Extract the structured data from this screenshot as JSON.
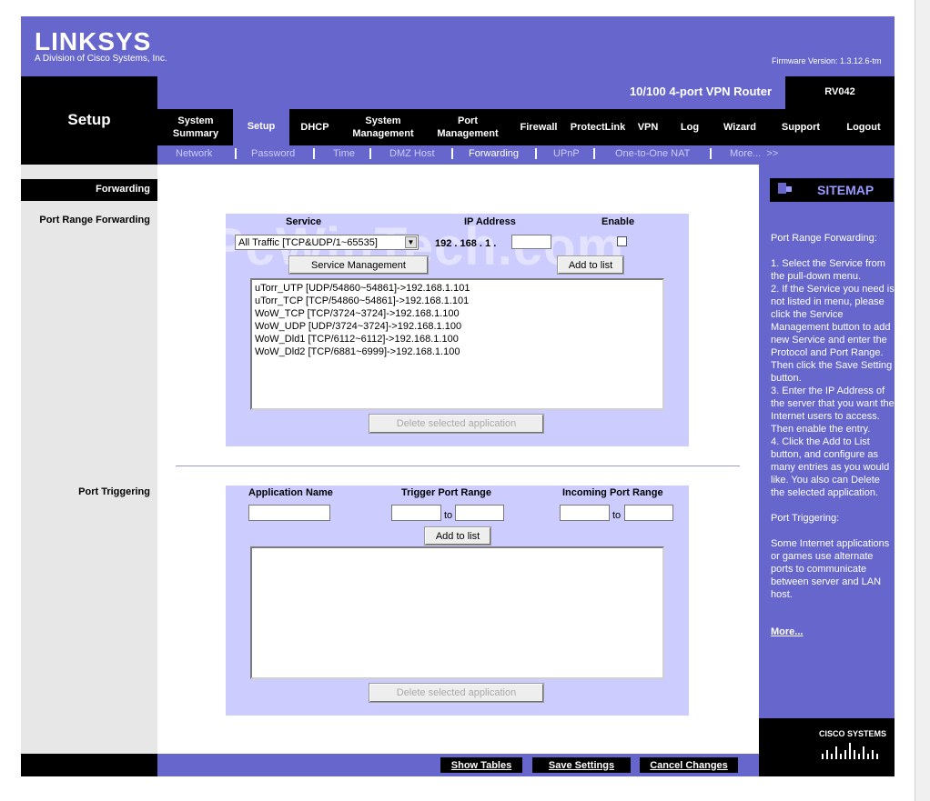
{
  "header": {
    "brand": "LINKSYS",
    "brand_tagline": "A Division of Cisco Systems, Inc.",
    "firmware": "Firmware Version: 1.3.12.6-tm",
    "product": "10/100 4-port VPN Router",
    "model": "RV042",
    "section_title": "Setup"
  },
  "tabs": [
    {
      "label": "System\nSummary"
    },
    {
      "label": "Setup"
    },
    {
      "label": "DHCP"
    },
    {
      "label": "System\nManagement"
    },
    {
      "label": "Port\nManagement"
    },
    {
      "label": "Firewall"
    },
    {
      "label": "ProtectLink"
    },
    {
      "label": "VPN"
    },
    {
      "label": "Log"
    },
    {
      "label": "Wizard"
    },
    {
      "label": "Support"
    },
    {
      "label": "Logout"
    }
  ],
  "subtabs": [
    {
      "label": "Network"
    },
    {
      "label": "Password"
    },
    {
      "label": "Time"
    },
    {
      "label": "DMZ Host"
    },
    {
      "label": "Forwarding"
    },
    {
      "label": "UPnP"
    },
    {
      "label": "One-to-One NAT"
    },
    {
      "label": "More...  >>"
    }
  ],
  "left": {
    "section": "Forwarding",
    "port_range_forwarding": "Port Range Forwarding",
    "port_triggering": "Port Triggering"
  },
  "forwarding": {
    "col_service": "Service",
    "col_ip": "IP Address",
    "col_enable": "Enable",
    "service_selected": "All Traffic [TCP&UDP/1~65535]",
    "ip_prefix": "192 . 168 . 1 .",
    "ip_last": "",
    "service_mgmt_btn": "Service Management",
    "add_btn": "Add to list",
    "entries": [
      "uTorr_UTP [UDP/54860~54861]->192.168.1.101",
      "uTorr_TCP [TCP/54860~54861]->192.168.1.101",
      "WoW_TCP [TCP/3724~3724]->192.168.1.100",
      "WoW_UDP [UDP/3724~3724]->192.168.1.100",
      "WoW_Dld1 [TCP/6112~6112]->192.168.1.100",
      "WoW_Dld2 [TCP/6881~6999]->192.168.1.100"
    ],
    "delete_btn": "Delete selected application"
  },
  "triggering": {
    "col_app": "Application Name",
    "col_trigger": "Trigger Port Range",
    "col_incoming": "Incoming Port Range",
    "to": "to",
    "add_btn": "Add to list",
    "delete_btn": "Delete selected application"
  },
  "sitemap": {
    "title": "SITEMAP",
    "help": "Port Range Forwarding:\n\n1. Select the Service from the pull-down menu.\n2. If the Service you need is not listed in menu, please click the Service Management button to add new Service and enter the Protocol and Port Range. Then click the Save Setting button.\n3. Enter the IP Address of the server that you want the Internet users to access. Then enable the entry.\n4. Click the Add to List button, and configure as many entries as you would like. You also can Delete the selected application.\n\nPort Triggering:\n\nSome Internet applications or games use alternate ports to communicate between server and LAN host.",
    "more": "More..."
  },
  "footer": {
    "show_tables": "Show Tables",
    "save": "Save Settings",
    "cancel": "Cancel Changes",
    "cisco": "CISCO SYSTEMS"
  },
  "watermark": "PcWinTech.com",
  "colors": {
    "purple": "#6666cc",
    "panel": "#ccccff",
    "black": "#000000"
  }
}
